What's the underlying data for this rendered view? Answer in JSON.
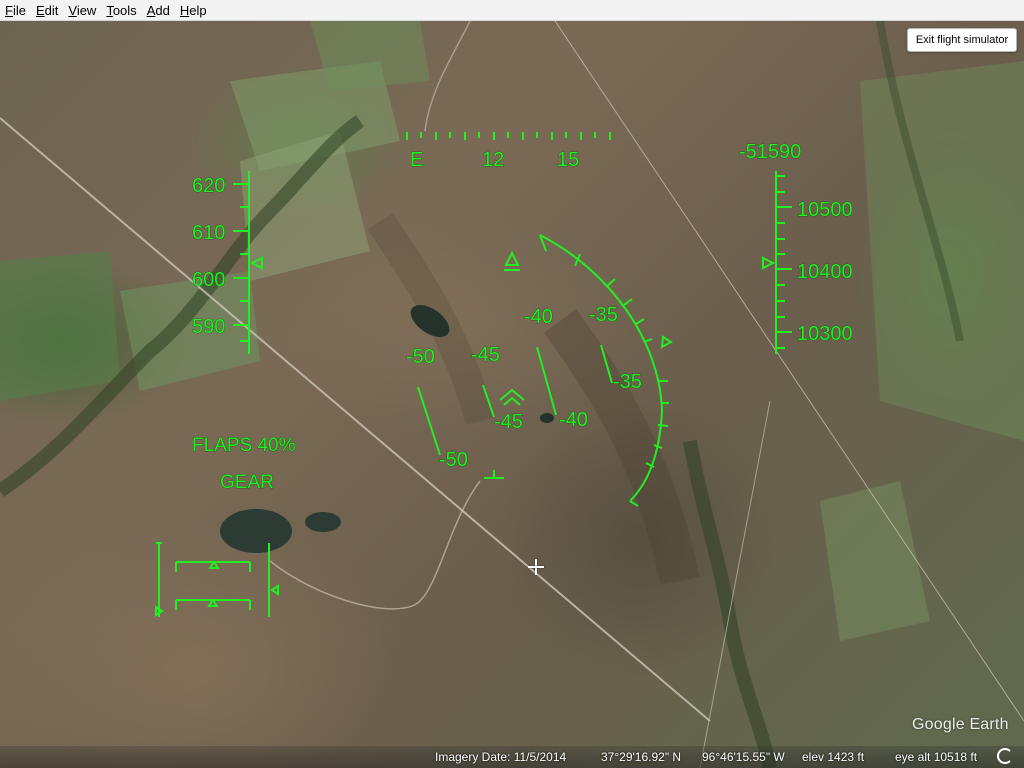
{
  "menu": [
    "File",
    "Edit",
    "View",
    "Tools",
    "Add",
    "Help"
  ],
  "menu_mnemonics": [
    "F",
    "E",
    "V",
    "T",
    "A",
    "H"
  ],
  "exit_button": "Exit flight simulator",
  "hud": {
    "heading_labels": [
      "E",
      "12",
      "15"
    ],
    "vertical_speed": "-51590",
    "speed_ticks": [
      "620",
      "610",
      "600",
      "590"
    ],
    "altitude_ticks": [
      "10500",
      "10400",
      "10300"
    ],
    "pitch_labels": [
      "-50",
      "-45",
      "-40",
      "-35",
      "-35",
      "-40",
      "-45",
      "-50"
    ],
    "flaps": "FLAPS 40%",
    "gear": "GEAR",
    "color": "#22ee22"
  },
  "status": {
    "imagery_date": "Imagery Date: 11/5/2014",
    "lat": "37°29'16.92\" N",
    "lon": "96°46'15.55\" W",
    "elev": "elev  1423 ft",
    "eye_alt": "eye alt  10518 ft"
  },
  "logo": "Google Earth"
}
